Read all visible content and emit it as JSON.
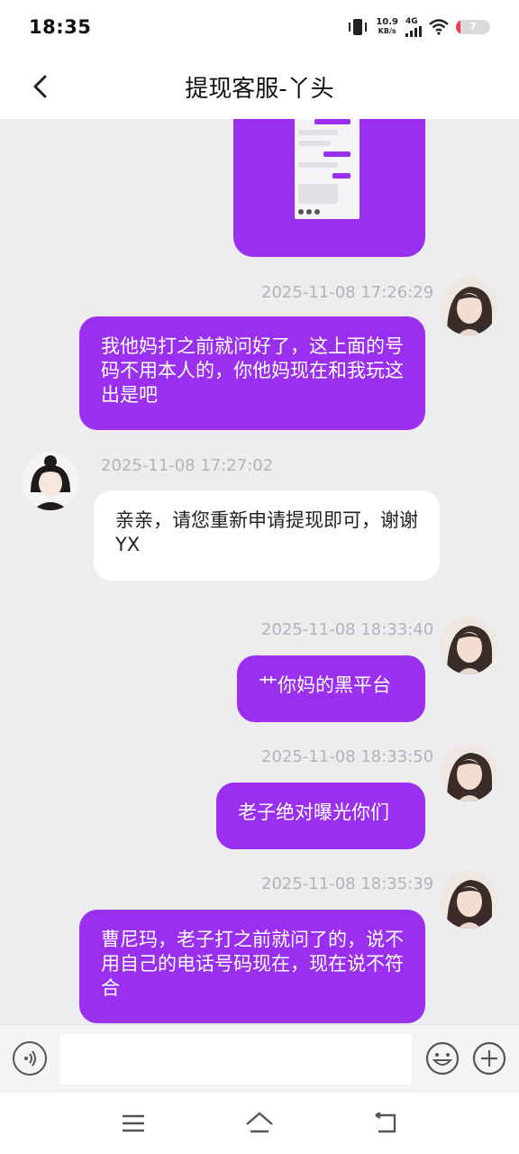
{
  "status_bar": {
    "time": "18:35",
    "net_speed_value": "10.9",
    "net_speed_unit": "KB/s",
    "network_type": "4G",
    "battery": "7",
    "icons": [
      "vibrate-icon",
      "signal-icon",
      "wifi-icon",
      "battery-icon"
    ]
  },
  "header": {
    "title": "提现客服-丫头",
    "back_icon": "chevron-left-icon"
  },
  "messages": [
    {
      "direction": "out",
      "timestamp": "2025-11-08 17:26:29",
      "text": "我他妈打之前就问好了，这上面的号码不用本人的，你他妈现在和我玩这出是吧"
    },
    {
      "direction": "in",
      "timestamp": "2025-11-08 17:27:02",
      "text": "亲亲，请您重新申请提现即可，谢谢YX"
    },
    {
      "direction": "out",
      "timestamp": "2025-11-08 18:33:40",
      "text": "艹你妈的黑平台"
    },
    {
      "direction": "out",
      "timestamp": "2025-11-08 18:33:50",
      "text": "老子绝对曝光你们"
    },
    {
      "direction": "out",
      "timestamp": "2025-11-08 18:35:39",
      "text": "曹尼玛，老子打之前就问了的，说不用自己的电话号码现在，现在说不符合"
    }
  ],
  "input_bar": {
    "placeholder": "",
    "value": "",
    "icons": [
      "voice-icon",
      "emoji-icon",
      "plus-icon"
    ]
  },
  "nav_bar": {
    "icons": [
      "menu-icon",
      "home-icon",
      "back-icon"
    ]
  },
  "colors": {
    "accent": "#9a2ff0",
    "chat_background": "#ededef",
    "incoming_bubble": "#ffffff",
    "timestamp": "#b3b3b8"
  }
}
